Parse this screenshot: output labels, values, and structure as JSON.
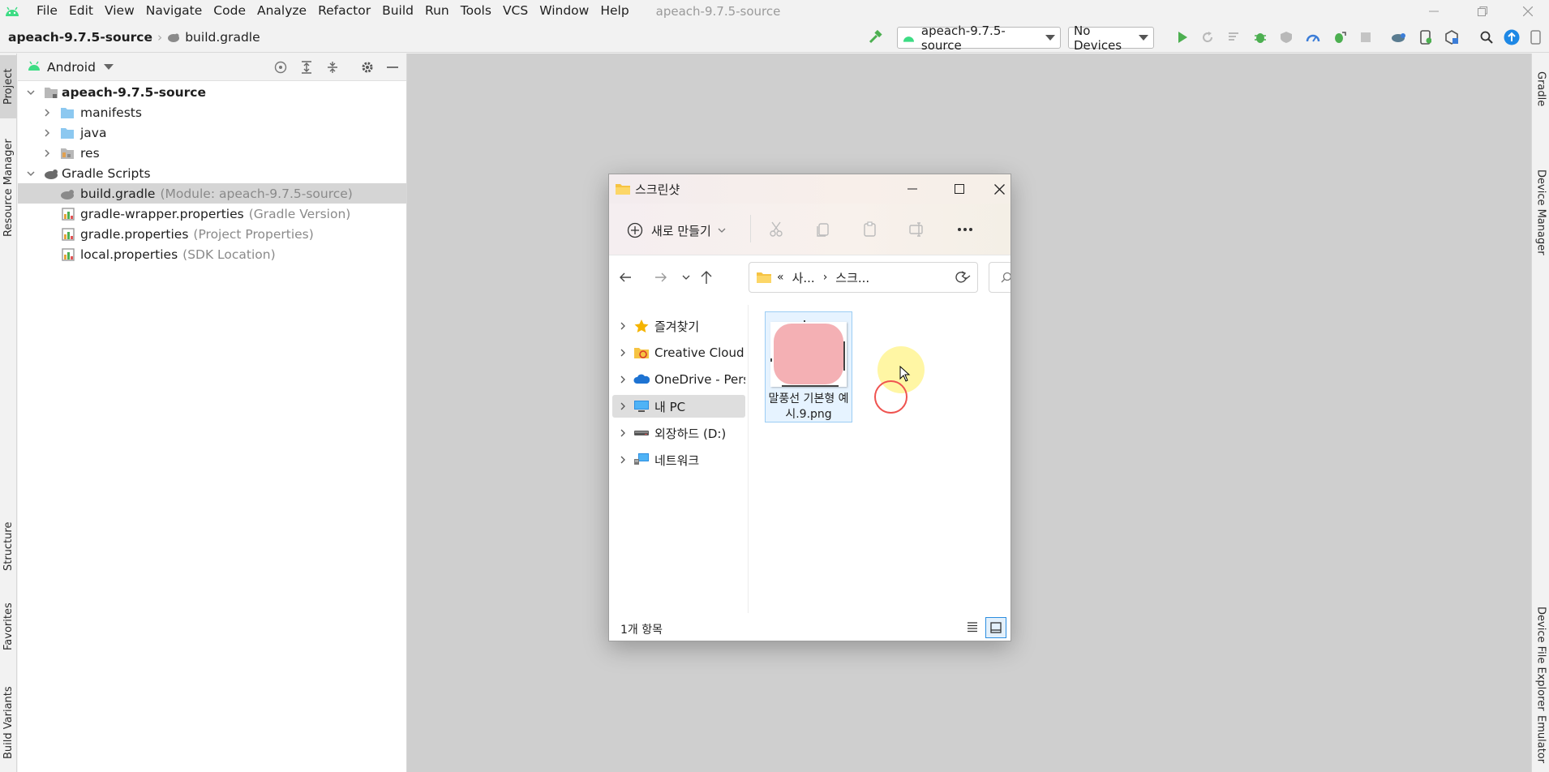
{
  "menubar": {
    "items": [
      "File",
      "Edit",
      "View",
      "Navigate",
      "Code",
      "Analyze",
      "Refactor",
      "Build",
      "Run",
      "Tools",
      "VCS",
      "Window",
      "Help"
    ],
    "window_title": "apeach-9.7.5-source"
  },
  "navbar": {
    "project": "apeach-9.7.5-source",
    "file": "build.gradle",
    "run_config": "apeach-9.7.5-source",
    "device": "No Devices"
  },
  "left_stripe": {
    "project": "Project",
    "resource_manager": "Resource Manager",
    "structure": "Structure",
    "favorites": "Favorites",
    "build_variants": "Build Variants"
  },
  "right_stripe": {
    "gradle": "Gradle",
    "device_manager": "Device Manager",
    "device_file_explorer": "Device File Explorer",
    "emulator": "Emulator"
  },
  "project_panel": {
    "view": "Android",
    "tree": [
      {
        "label": "apeach-9.7.5-source",
        "hint": ""
      },
      {
        "label": "manifests",
        "hint": ""
      },
      {
        "label": "java",
        "hint": ""
      },
      {
        "label": "res",
        "hint": ""
      },
      {
        "label": "Gradle Scripts",
        "hint": ""
      },
      {
        "label": "build.gradle",
        "hint": "(Module: apeach-9.7.5-source)"
      },
      {
        "label": "gradle-wrapper.properties",
        "hint": "(Gradle Version)"
      },
      {
        "label": "gradle.properties",
        "hint": "(Project Properties)"
      },
      {
        "label": "local.properties",
        "hint": "(SDK Location)"
      }
    ]
  },
  "explorer": {
    "title": "스크린샷",
    "new_button": "새로 만들기",
    "address": {
      "prefix": "«",
      "part1": "사...",
      "part2": "스크..."
    },
    "nav": [
      "즐겨찾기",
      "Creative Cloud F",
      "OneDrive - Persc",
      "내 PC",
      "외장하드 (D:)",
      "네트워크"
    ],
    "file": {
      "name": "말풍선 기본형 예시.9.png",
      "name_line1": "말풍선 기본형 예",
      "name_line2": "시.9.png"
    },
    "status": "1개 항목"
  },
  "colors": {
    "android_green": "#3ddc84",
    "run_green": "#4caf50",
    "thumb_pink": "#f4b0b4",
    "folder_yellow": "#f6c342",
    "click_highlight": "#fff59a",
    "click_ring": "#ef5350"
  }
}
